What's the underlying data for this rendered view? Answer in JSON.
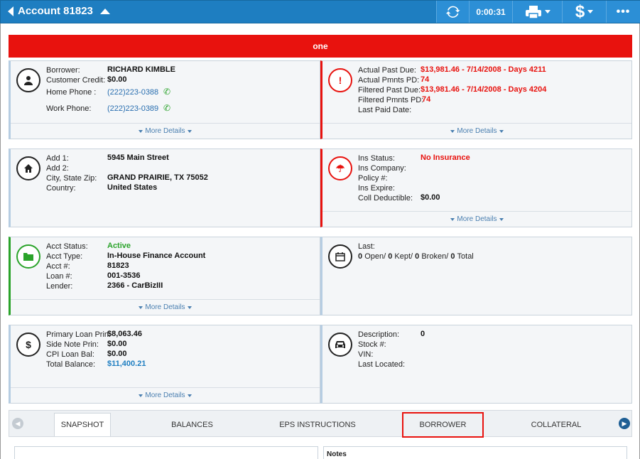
{
  "header": {
    "title": "Account 81823",
    "timer": "0:00:31",
    "refresh_icon": "refresh-icon",
    "print_icon": "printer-icon",
    "dollar_icon": "dollar-icon",
    "more_icon": "more-icon"
  },
  "banner": {
    "text": "one"
  },
  "borrower_card": {
    "labels": [
      "Borrower:",
      "Customer Credit:",
      "Home Phone :",
      "Work Phone:"
    ],
    "borrower": "RICHARD KIMBLE",
    "credit": "$0.00",
    "home_phone": "(222)223-0388",
    "work_phone": "(222)223-0389",
    "more": "More Details"
  },
  "pastdue_card": {
    "labels": [
      "Actual Past Due:",
      "Actual Pmnts PD:",
      "Filtered Past Due:",
      "Filtered Pmnts PD:",
      "Last Paid Date:"
    ],
    "actual_past_due": "$13,981.46 - 7/14/2008 - Days 4211",
    "actual_pmnts": "74",
    "filtered_past_due": "$13,981.46 - 7/14/2008 - Days 4204",
    "filtered_pmnts": "74",
    "more": "More Details"
  },
  "address_card": {
    "labels": [
      "Add 1:",
      "Add 2:",
      "City, State Zip:",
      "Country:"
    ],
    "add1": "5945 Main Street",
    "city": "GRAND PRAIRIE, TX 75052",
    "country": "United States"
  },
  "insurance_card": {
    "labels": [
      "Ins Status:",
      "Ins Company:",
      "Policy #:",
      "Ins Expire:",
      "Coll Deductible:"
    ],
    "status": "No Insurance",
    "deductible": "$0.00",
    "more": "More Details"
  },
  "account_card": {
    "labels": [
      "Acct Status:",
      "Acct Type:",
      "Acct #:",
      "Loan #:",
      "Lender:"
    ],
    "status": "Active",
    "type": "In-House Finance Account",
    "acct": "81823",
    "loan": "001-3536",
    "lender": "2366 - CarBizIII",
    "more": "More Details"
  },
  "promise_card": {
    "label": "Last:",
    "counts": [
      "0",
      "0",
      "0",
      "0"
    ],
    "words": [
      "Open/",
      "Kept/",
      "Broken/",
      "Total"
    ]
  },
  "balance_card": {
    "labels": [
      "Primary Loan Prin:",
      "Side Note Prin:",
      "CPI Loan Bal:",
      "Total Balance:"
    ],
    "primary": "$8,063.46",
    "side": "$0.00",
    "cpi": "$0.00",
    "total": "$11,400.21",
    "more": "More Details"
  },
  "vehicle_card": {
    "labels": [
      "Description:",
      "Stock #:",
      "VIN:",
      "Last Located:"
    ],
    "description": "0"
  },
  "tabs": [
    "SNAPSHOT",
    "BALANCES",
    "EPS INSTRUCTIONS",
    "BORROWER",
    "COLLATERAL"
  ],
  "bottom": {
    "notes": "Notes"
  },
  "colors": {
    "brand": "#1e7ec1",
    "alert": "#e8120e",
    "ok": "#2aa32a"
  }
}
